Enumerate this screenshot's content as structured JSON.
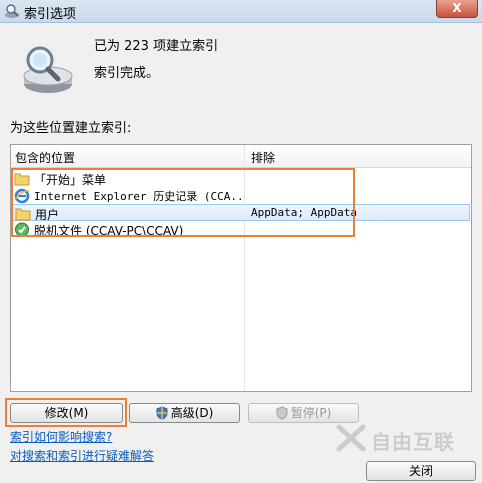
{
  "window": {
    "title": "索引选项",
    "close_glyph": "X"
  },
  "status": {
    "count_text": "已为 223 项建立索引",
    "state_text": "索引完成。"
  },
  "locations": {
    "label": "为这些位置建立索引:",
    "columns": {
      "included": "包含的位置",
      "excluded": "排除"
    },
    "rows": [
      {
        "icon": "folder-icon",
        "name": "「开始」菜单",
        "excluded": ""
      },
      {
        "icon": "ie-icon",
        "name": "Internet Explorer 历史记录 (CCA...",
        "excluded": ""
      },
      {
        "icon": "folder-icon",
        "name": "用户",
        "excluded": "AppData; AppData",
        "selected": true
      },
      {
        "icon": "offline-files-icon",
        "name": "脱机文件 (CCAV-PC\\CCAV)",
        "excluded": ""
      }
    ]
  },
  "buttons": {
    "modify": "修改(M)",
    "advanced": "高级(D)",
    "pause": "暂停(P)",
    "close": "关闭"
  },
  "links": {
    "how_affects_search": "索引如何影响搜索?",
    "troubleshoot": "对搜索和索引进行疑难解答"
  },
  "watermark": {
    "text": "自由互联"
  },
  "colors": {
    "highlight": "#e8803a",
    "link": "#0b5bbd",
    "selection": "#dbeafb"
  }
}
